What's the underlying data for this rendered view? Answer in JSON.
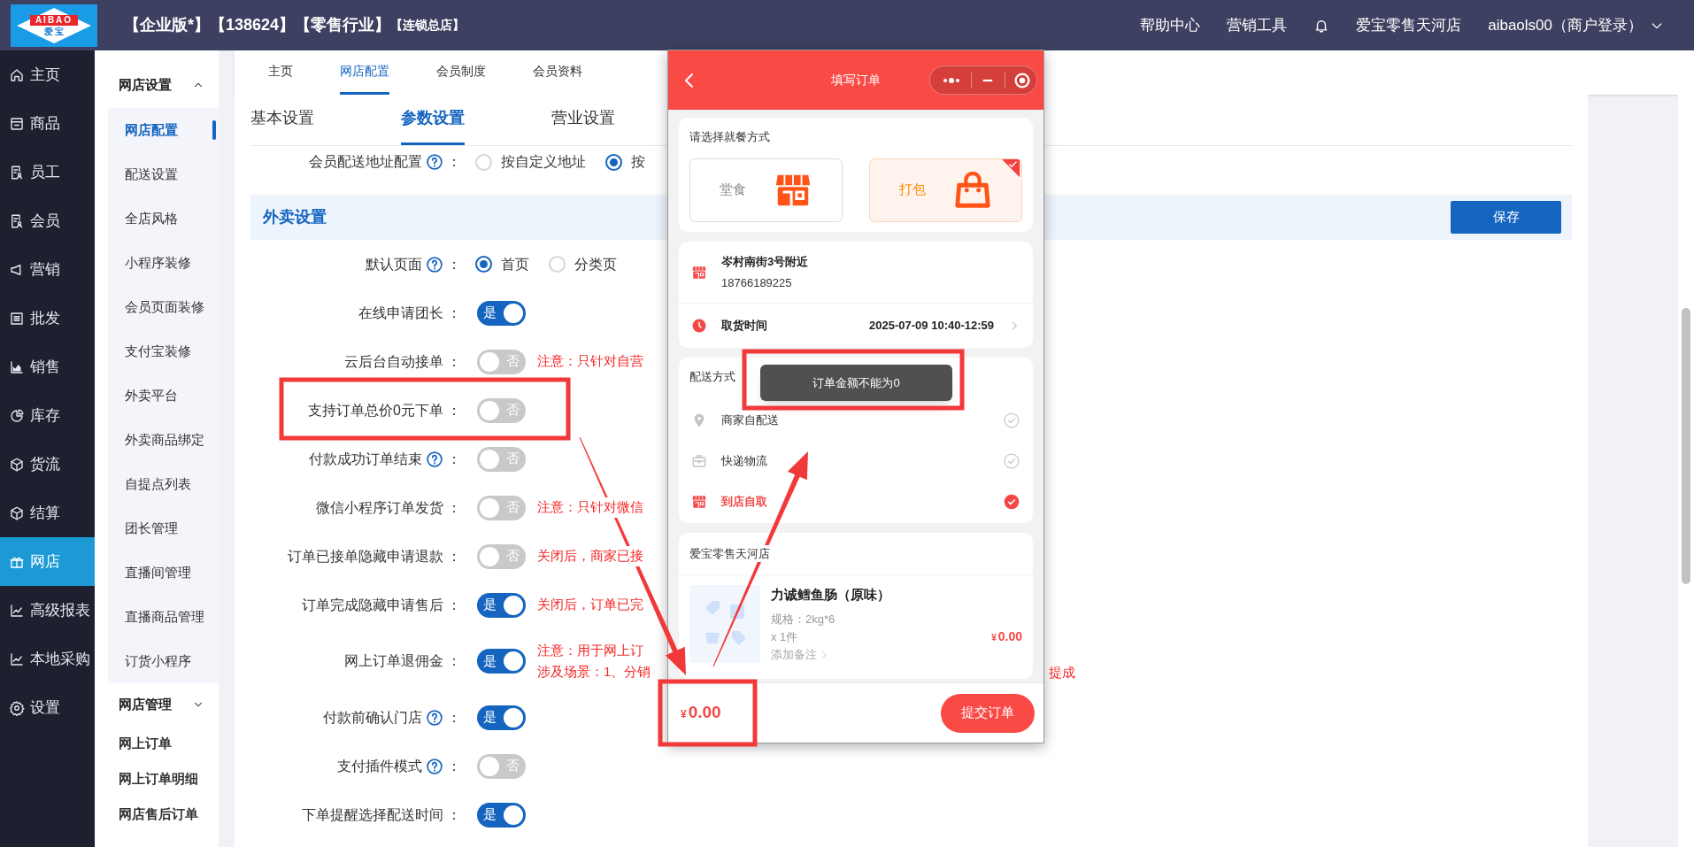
{
  "header": {
    "logo_top": "AIBAO",
    "logo_bottom": "爱 宝",
    "title": "【企业版*】【138624】【零售行业】",
    "title_tag": "【连锁总店】",
    "links": [
      "帮助中心",
      "营销工具"
    ],
    "store": "爱宝零售天河店",
    "account": "aibaols00（商户登录）"
  },
  "sidebar": {
    "items": [
      {
        "label": "主页",
        "kind": "home",
        "selected": false
      },
      {
        "label": "商品",
        "kind": "goods",
        "selected": false
      },
      {
        "label": "员工",
        "kind": "doc",
        "selected": false
      },
      {
        "label": "会员",
        "kind": "doc",
        "selected": false
      },
      {
        "label": "营销",
        "kind": "megaphone",
        "selected": false
      },
      {
        "label": "批发",
        "kind": "list",
        "selected": false
      },
      {
        "label": "销售",
        "kind": "area",
        "selected": false
      },
      {
        "label": "库存",
        "kind": "pie",
        "selected": false
      },
      {
        "label": "货流",
        "kind": "cube",
        "selected": false
      },
      {
        "label": "结算",
        "kind": "cube",
        "selected": false
      },
      {
        "label": "网店",
        "kind": "gift",
        "selected": true
      },
      {
        "label": "高级报表",
        "kind": "line",
        "selected": false
      },
      {
        "label": "本地采购",
        "kind": "line",
        "selected": false
      },
      {
        "label": "设置",
        "kind": "gear",
        "selected": false
      }
    ]
  },
  "subnav": {
    "groups": [
      {
        "title": "网店设置",
        "expanded": true,
        "items": [
          {
            "label": "网店配置",
            "selected": true
          },
          {
            "label": "配送设置",
            "selected": false
          },
          {
            "label": "全店风格",
            "selected": false
          },
          {
            "label": "小程序装修",
            "selected": false
          },
          {
            "label": "会员页面装修",
            "selected": false
          },
          {
            "label": "支付宝装修",
            "selected": false
          },
          {
            "label": "外卖平台",
            "selected": false
          },
          {
            "label": "外卖商品绑定",
            "selected": false
          },
          {
            "label": "自提点列表",
            "selected": false
          },
          {
            "label": "团长管理",
            "selected": false
          },
          {
            "label": "直播间管理",
            "selected": false
          },
          {
            "label": "直播商品管理",
            "selected": false
          },
          {
            "label": "订货小程序",
            "selected": false
          }
        ]
      },
      {
        "title": "网店管理",
        "expanded": false,
        "items": [
          {
            "label": "网上订单",
            "selected": false
          },
          {
            "label": "网上订单明细",
            "selected": false
          },
          {
            "label": "网店售后订单",
            "selected": false
          }
        ]
      }
    ]
  },
  "top_tabs": [
    {
      "label": "主页",
      "selected": false
    },
    {
      "label": "网店配置",
      "selected": true
    },
    {
      "label": "会员制度",
      "selected": false
    },
    {
      "label": "会员资料",
      "selected": false
    }
  ],
  "param_tabs": [
    {
      "label": "基本设置",
      "selected": false
    },
    {
      "label": "参数设置",
      "selected": true
    },
    {
      "label": "营业设置",
      "selected": false
    }
  ],
  "address_row": {
    "label": "会员配送地址配置",
    "help": true,
    "suffix": "：",
    "options": [
      {
        "label": "按自定义地址",
        "selected": false
      },
      {
        "label": "按",
        "selected": true
      }
    ]
  },
  "section": {
    "title": "外卖设置",
    "save": "保存"
  },
  "rows": [
    {
      "label": "默认页面",
      "help": true,
      "suffix": "：",
      "kind": "radio",
      "options": [
        {
          "label": "首页",
          "selected": true
        },
        {
          "label": "分类页",
          "selected": false
        }
      ]
    },
    {
      "label": "在线申请团长",
      "help": false,
      "suffix": "：",
      "kind": "switch",
      "on": true,
      "switch_text": "是"
    },
    {
      "label": "云后台自动接单",
      "help": false,
      "suffix": "：",
      "kind": "switch",
      "on": false,
      "switch_text": "否",
      "notes": [
        "注意：只针对自营"
      ]
    },
    {
      "label": "支持订单总价0元下单",
      "help": false,
      "suffix": "：",
      "kind": "switch",
      "on": false,
      "switch_text": "否"
    },
    {
      "label": "付款成功订单结束",
      "help": true,
      "suffix": "：",
      "kind": "switch",
      "on": false,
      "switch_text": "否"
    },
    {
      "label": "微信小程序订单发货",
      "help": false,
      "suffix": "：",
      "kind": "switch",
      "on": false,
      "switch_text": "否",
      "notes": [
        "注意：只针对微信"
      ]
    },
    {
      "label": "订单已接单隐藏申请退款",
      "help": false,
      "suffix": "：",
      "kind": "switch",
      "on": false,
      "switch_text": "否",
      "notes": [
        "关闭后，商家已接"
      ]
    },
    {
      "label": "订单完成隐藏申请售后",
      "help": false,
      "suffix": "：",
      "kind": "switch",
      "on": true,
      "switch_text": "是",
      "notes": [
        "关闭后，订单已完"
      ]
    },
    {
      "label": "网上订单退佣金",
      "help": false,
      "suffix": "：",
      "kind": "switch",
      "on": true,
      "switch_text": "是",
      "notes": [
        "注意：用于网上订",
        "涉及场景：1、分销"
      ],
      "note_tail": "提成"
    },
    {
      "label": "付款前确认门店",
      "help": true,
      "suffix": "：",
      "kind": "switch",
      "on": true,
      "switch_text": "是"
    },
    {
      "label": "支付插件模式",
      "help": true,
      "suffix": "：",
      "kind": "switch",
      "on": false,
      "switch_text": "否"
    },
    {
      "label": "下单提醒选择配送时间",
      "help": false,
      "suffix": "：",
      "kind": "switch",
      "on": true,
      "switch_text": "是"
    }
  ],
  "phone": {
    "title": "填写订单",
    "dining": {
      "title": "请选择就餐方式",
      "options": [
        {
          "label": "堂食",
          "kind": "store",
          "selected": false
        },
        {
          "label": "打包",
          "kind": "bag",
          "selected": true
        }
      ]
    },
    "address": {
      "name": "岑村南街3号附近",
      "phone": "18766189225"
    },
    "pickup": {
      "label": "取货时间",
      "value": "2025-07-09 10:40-12:59"
    },
    "delivery": {
      "title": "配送方式",
      "options": [
        {
          "label": "商家自配送",
          "kind": "pin",
          "selected": false
        },
        {
          "label": "快递物流",
          "kind": "box",
          "selected": false
        },
        {
          "label": "到店自取",
          "kind": "store",
          "selected": true
        }
      ]
    },
    "store_name": "爱宝零售天河店",
    "product": {
      "name": "力诚鳕鱼肠（原味）",
      "spec": "规格：2kg*6",
      "qty": "x 1件",
      "remark": "添加备注",
      "currency": "¥",
      "price": "0.00"
    },
    "total": {
      "currency": "¥",
      "amount": "0.00"
    },
    "submit": "提交订单",
    "toast": "订单金额不能为0"
  }
}
